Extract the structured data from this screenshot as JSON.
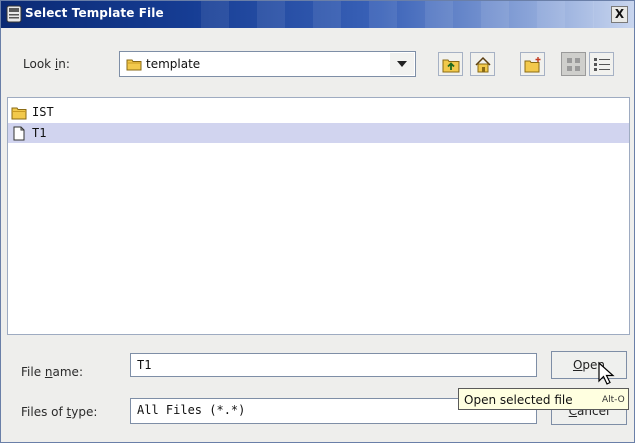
{
  "window": {
    "title": "Select Template File",
    "close_glyph": "X"
  },
  "lookin": {
    "label": "Look in:",
    "value": "template",
    "toolbar": {
      "up_icon": "folder-up-icon",
      "home_icon": "home-icon",
      "new_folder_icon": "new-folder-icon",
      "list_view_icon": "list-view-icon",
      "details_view_icon": "details-view-icon"
    }
  },
  "files": [
    {
      "name": "IST",
      "kind": "folder",
      "selected": false
    },
    {
      "name": "T1",
      "kind": "file",
      "selected": true
    }
  ],
  "filename": {
    "label": "File name:",
    "value": "T1"
  },
  "filetype": {
    "label": "Files of type:",
    "value": "All Files (*.*)"
  },
  "buttons": {
    "open": "Open",
    "cancel": "Cancel"
  },
  "tooltip": {
    "text": "Open selected file",
    "shortcut": "Alt-O"
  },
  "colors": {
    "titlebar": "#163d94",
    "selection": "#d1d4ef",
    "tooltip_bg": "#ffffe0"
  }
}
